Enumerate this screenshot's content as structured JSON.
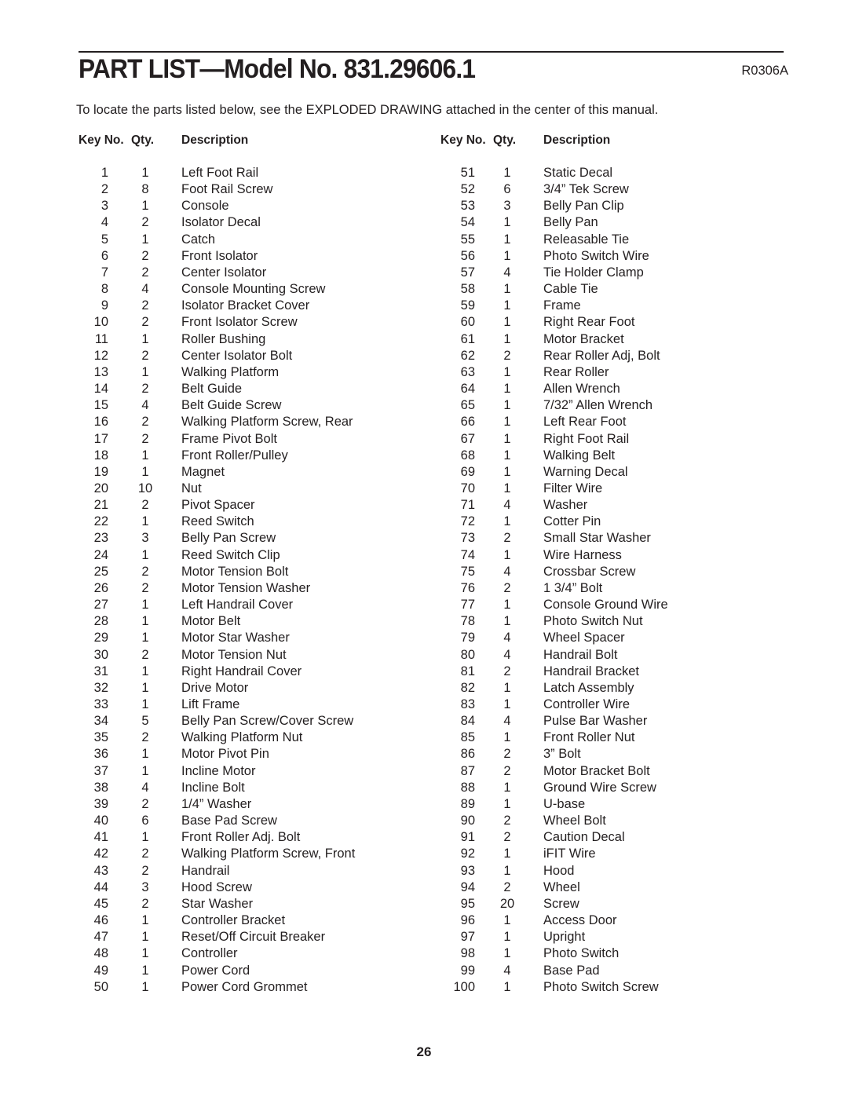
{
  "header": {
    "title": "PART LIST—Model No. 831.29606.1",
    "code": "R0306A",
    "intro": "To locate the parts listed below, see the EXPLODED DRAWING attached in the center of this manual."
  },
  "columns_header": {
    "key": "Key No.",
    "qty": "Qty.",
    "description": "Description"
  },
  "parts_left": [
    {
      "key": "1",
      "qty": "1",
      "desc": "Left Foot Rail"
    },
    {
      "key": "2",
      "qty": "8",
      "desc": "Foot Rail Screw"
    },
    {
      "key": "3",
      "qty": "1",
      "desc": "Console"
    },
    {
      "key": "4",
      "qty": "2",
      "desc": "Isolator Decal"
    },
    {
      "key": "5",
      "qty": "1",
      "desc": "Catch"
    },
    {
      "key": "6",
      "qty": "2",
      "desc": "Front Isolator"
    },
    {
      "key": "7",
      "qty": "2",
      "desc": "Center Isolator"
    },
    {
      "key": "8",
      "qty": "4",
      "desc": "Console Mounting Screw"
    },
    {
      "key": "9",
      "qty": "2",
      "desc": "Isolator Bracket Cover"
    },
    {
      "key": "10",
      "qty": "2",
      "desc": "Front Isolator Screw"
    },
    {
      "key": "11",
      "qty": "1",
      "desc": "Roller Bushing"
    },
    {
      "key": "12",
      "qty": "2",
      "desc": "Center Isolator Bolt"
    },
    {
      "key": "13",
      "qty": "1",
      "desc": "Walking Platform"
    },
    {
      "key": "14",
      "qty": "2",
      "desc": "Belt Guide"
    },
    {
      "key": "15",
      "qty": "4",
      "desc": "Belt Guide Screw"
    },
    {
      "key": "16",
      "qty": "2",
      "desc": "Walking Platform Screw, Rear"
    },
    {
      "key": "17",
      "qty": "2",
      "desc": "Frame Pivot Bolt"
    },
    {
      "key": "18",
      "qty": "1",
      "desc": "Front Roller/Pulley"
    },
    {
      "key": "19",
      "qty": "1",
      "desc": "Magnet"
    },
    {
      "key": "20",
      "qty": "10",
      "desc": "Nut"
    },
    {
      "key": "21",
      "qty": "2",
      "desc": "Pivot Spacer"
    },
    {
      "key": "22",
      "qty": "1",
      "desc": "Reed Switch"
    },
    {
      "key": "23",
      "qty": "3",
      "desc": "Belly Pan Screw"
    },
    {
      "key": "24",
      "qty": "1",
      "desc": "Reed Switch Clip"
    },
    {
      "key": "25",
      "qty": "2",
      "desc": "Motor Tension Bolt"
    },
    {
      "key": "26",
      "qty": "2",
      "desc": "Motor Tension Washer"
    },
    {
      "key": "27",
      "qty": "1",
      "desc": "Left Handrail Cover"
    },
    {
      "key": "28",
      "qty": "1",
      "desc": "Motor Belt"
    },
    {
      "key": "29",
      "qty": "1",
      "desc": "Motor Star Washer"
    },
    {
      "key": "30",
      "qty": "2",
      "desc": "Motor Tension Nut"
    },
    {
      "key": "31",
      "qty": "1",
      "desc": "Right Handrail Cover"
    },
    {
      "key": "32",
      "qty": "1",
      "desc": "Drive Motor"
    },
    {
      "key": "33",
      "qty": "1",
      "desc": "Lift Frame"
    },
    {
      "key": "34",
      "qty": "5",
      "desc": "Belly Pan Screw/Cover Screw"
    },
    {
      "key": "35",
      "qty": "2",
      "desc": "Walking Platform Nut"
    },
    {
      "key": "36",
      "qty": "1",
      "desc": "Motor Pivot Pin"
    },
    {
      "key": "37",
      "qty": "1",
      "desc": "Incline Motor"
    },
    {
      "key": "38",
      "qty": "4",
      "desc": "Incline Bolt"
    },
    {
      "key": "39",
      "qty": "2",
      "desc": "1/4” Washer"
    },
    {
      "key": "40",
      "qty": "6",
      "desc": "Base Pad Screw"
    },
    {
      "key": "41",
      "qty": "1",
      "desc": "Front Roller Adj. Bolt"
    },
    {
      "key": "42",
      "qty": "2",
      "desc": "Walking Platform Screw, Front"
    },
    {
      "key": "43",
      "qty": "2",
      "desc": "Handrail"
    },
    {
      "key": "44",
      "qty": "3",
      "desc": "Hood Screw"
    },
    {
      "key": "45",
      "qty": "2",
      "desc": "Star Washer"
    },
    {
      "key": "46",
      "qty": "1",
      "desc": "Controller Bracket"
    },
    {
      "key": "47",
      "qty": "1",
      "desc": "Reset/Off Circuit Breaker"
    },
    {
      "key": "48",
      "qty": "1",
      "desc": "Controller"
    },
    {
      "key": "49",
      "qty": "1",
      "desc": "Power Cord"
    },
    {
      "key": "50",
      "qty": "1",
      "desc": "Power Cord Grommet"
    }
  ],
  "parts_right": [
    {
      "key": "51",
      "qty": "1",
      "desc": "Static Decal"
    },
    {
      "key": "52",
      "qty": "6",
      "desc": "3/4” Tek Screw"
    },
    {
      "key": "53",
      "qty": "3",
      "desc": "Belly Pan Clip"
    },
    {
      "key": "54",
      "qty": "1",
      "desc": "Belly Pan"
    },
    {
      "key": "55",
      "qty": "1",
      "desc": "Releasable Tie"
    },
    {
      "key": "56",
      "qty": "1",
      "desc": "Photo Switch Wire"
    },
    {
      "key": "57",
      "qty": "4",
      "desc": "Tie Holder Clamp"
    },
    {
      "key": "58",
      "qty": "1",
      "desc": "Cable Tie"
    },
    {
      "key": "59",
      "qty": "1",
      "desc": "Frame"
    },
    {
      "key": "60",
      "qty": "1",
      "desc": "Right Rear Foot"
    },
    {
      "key": "61",
      "qty": "1",
      "desc": "Motor Bracket"
    },
    {
      "key": "62",
      "qty": "2",
      "desc": "Rear Roller Adj, Bolt"
    },
    {
      "key": "63",
      "qty": "1",
      "desc": "Rear Roller"
    },
    {
      "key": "64",
      "qty": "1",
      "desc": "Allen Wrench"
    },
    {
      "key": "65",
      "qty": "1",
      "desc": "7/32” Allen Wrench"
    },
    {
      "key": "66",
      "qty": "1",
      "desc": "Left Rear Foot"
    },
    {
      "key": "67",
      "qty": "1",
      "desc": "Right Foot Rail"
    },
    {
      "key": "68",
      "qty": "1",
      "desc": "Walking Belt"
    },
    {
      "key": "69",
      "qty": "1",
      "desc": "Warning Decal"
    },
    {
      "key": "70",
      "qty": "1",
      "desc": "Filter Wire"
    },
    {
      "key": "71",
      "qty": "4",
      "desc": "Washer"
    },
    {
      "key": "72",
      "qty": "1",
      "desc": "Cotter Pin"
    },
    {
      "key": "73",
      "qty": "2",
      "desc": "Small Star Washer"
    },
    {
      "key": "74",
      "qty": "1",
      "desc": "Wire Harness"
    },
    {
      "key": "75",
      "qty": "4",
      "desc": "Crossbar Screw"
    },
    {
      "key": "76",
      "qty": "2",
      "desc": "1 3/4” Bolt"
    },
    {
      "key": "77",
      "qty": "1",
      "desc": "Console Ground Wire"
    },
    {
      "key": "78",
      "qty": "1",
      "desc": "Photo Switch Nut"
    },
    {
      "key": "79",
      "qty": "4",
      "desc": "Wheel Spacer"
    },
    {
      "key": "80",
      "qty": "4",
      "desc": "Handrail Bolt"
    },
    {
      "key": "81",
      "qty": "2",
      "desc": "Handrail Bracket"
    },
    {
      "key": "82",
      "qty": "1",
      "desc": "Latch Assembly"
    },
    {
      "key": "83",
      "qty": "1",
      "desc": "Controller Wire"
    },
    {
      "key": "84",
      "qty": "4",
      "desc": "Pulse Bar Washer"
    },
    {
      "key": "85",
      "qty": "1",
      "desc": "Front Roller Nut"
    },
    {
      "key": "86",
      "qty": "2",
      "desc": "3” Bolt"
    },
    {
      "key": "87",
      "qty": "2",
      "desc": "Motor Bracket Bolt"
    },
    {
      "key": "88",
      "qty": "1",
      "desc": "Ground Wire Screw"
    },
    {
      "key": "89",
      "qty": "1",
      "desc": "U-base"
    },
    {
      "key": "90",
      "qty": "2",
      "desc": "Wheel Bolt"
    },
    {
      "key": "91",
      "qty": "2",
      "desc": "Caution Decal"
    },
    {
      "key": "92",
      "qty": "1",
      "desc": "iFIT Wire"
    },
    {
      "key": "93",
      "qty": "1",
      "desc": "Hood"
    },
    {
      "key": "94",
      "qty": "2",
      "desc": "Wheel"
    },
    {
      "key": "95",
      "qty": "20",
      "desc": "Screw"
    },
    {
      "key": "96",
      "qty": "1",
      "desc": "Access Door"
    },
    {
      "key": "97",
      "qty": "1",
      "desc": "Upright"
    },
    {
      "key": "98",
      "qty": "1",
      "desc": "Photo Switch"
    },
    {
      "key": "99",
      "qty": "4",
      "desc": "Base Pad"
    },
    {
      "key": "100",
      "qty": "1",
      "desc": "Photo Switch Screw"
    }
  ],
  "footer": {
    "page_number": "26"
  }
}
